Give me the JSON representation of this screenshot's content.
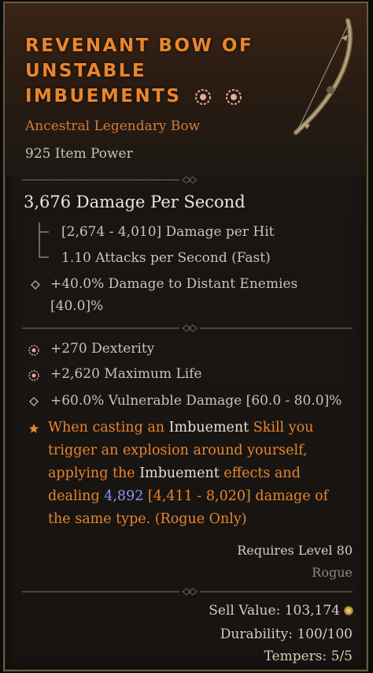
{
  "item": {
    "name_line1": "REVENANT BOW OF",
    "name_line2": "UNSTABLE",
    "name_line3": "IMBUEMENTS",
    "type": "Ancestral Legendary Bow",
    "item_power": "925 Item Power"
  },
  "weapon": {
    "dps": "3,676 Damage Per Second",
    "damage_per_hit": "[2,674 - 4,010] Damage per Hit",
    "attack_speed": "1.10 Attacks per Second (Fast)",
    "implicit_line1": "+40.0% Damage to Distant Enemies",
    "implicit_line2": "[40.0]%"
  },
  "affixes": [
    {
      "text": "+270 Dexterity",
      "bullet": "greater-affix-icon"
    },
    {
      "text": "+2,620 Maximum Life",
      "bullet": "greater-affix-icon"
    },
    {
      "text": "+60.0% Vulnerable Damage [60.0 - 80.0]%",
      "bullet": "diamond-icon"
    }
  ],
  "aspect": {
    "p1": "When casting an ",
    "kw1": "Imbuement",
    "p2": " Skill you trigger an explosion around yourself, applying the ",
    "kw2": "Imbuement",
    "p3": " effects and dealing ",
    "value": "4,892",
    "p4": " [4,411 - 8,020] damage of the same type. (Rogue Only)"
  },
  "requirements": {
    "level": "Requires Level 80",
    "class": "Rogue"
  },
  "footer": {
    "sell_value": "Sell Value: 103,174",
    "durability": "Durability: 100/100",
    "tempers": "Tempers: 5/5"
  },
  "colors": {
    "legendary_orange": "#e9852e",
    "magic_blue": "#8c95ee",
    "text_light": "#c9c2b6",
    "greater_affix": "#e7a89a"
  }
}
